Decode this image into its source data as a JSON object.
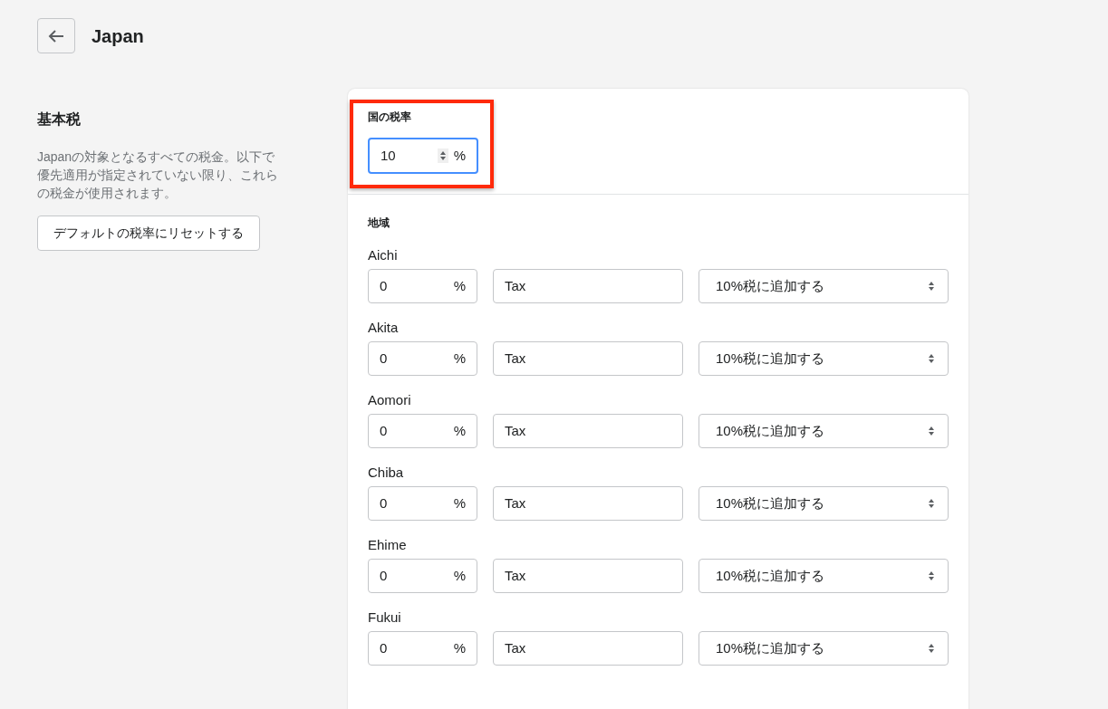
{
  "header": {
    "title": "Japan"
  },
  "base_tax": {
    "heading": "基本税",
    "description": "Japanの対象となるすべての税金。以下で優先適用が指定されていない限り、これらの税金が使用されます。",
    "reset_button": "デフォルトの税率にリセットする"
  },
  "country_rate": {
    "label": "国の税率",
    "value": "10",
    "unit": "%",
    "focused": true,
    "highlighted": true
  },
  "regions": {
    "heading": "地域",
    "items": [
      {
        "name": "Aichi",
        "rate": "0",
        "unit": "%",
        "tax_name": "Tax",
        "mode": "10%税に追加する"
      },
      {
        "name": "Akita",
        "rate": "0",
        "unit": "%",
        "tax_name": "Tax",
        "mode": "10%税に追加する"
      },
      {
        "name": "Aomori",
        "rate": "0",
        "unit": "%",
        "tax_name": "Tax",
        "mode": "10%税に追加する"
      },
      {
        "name": "Chiba",
        "rate": "0",
        "unit": "%",
        "tax_name": "Tax",
        "mode": "10%税に追加する"
      },
      {
        "name": "Ehime",
        "rate": "0",
        "unit": "%",
        "tax_name": "Tax",
        "mode": "10%税に追加する"
      },
      {
        "name": "Fukui",
        "rate": "0",
        "unit": "%",
        "tax_name": "Tax",
        "mode": "10%税に追加する"
      }
    ]
  }
}
